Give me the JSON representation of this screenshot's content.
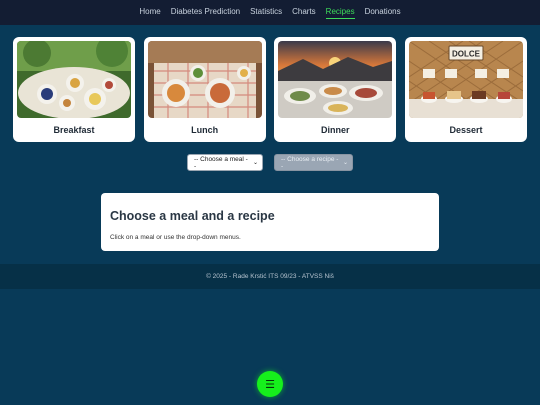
{
  "nav": {
    "items": [
      {
        "label": "Home"
      },
      {
        "label": "Diabetes Prediction"
      },
      {
        "label": "Statistics"
      },
      {
        "label": "Charts"
      },
      {
        "label": "Recipes",
        "active": true
      },
      {
        "label": "Donations"
      }
    ],
    "active_color": "#3ddc5a"
  },
  "meals": [
    {
      "label": "Breakfast"
    },
    {
      "label": "Lunch"
    },
    {
      "label": "Dinner"
    },
    {
      "label": "Dessert",
      "sign_text": "DOLCE"
    }
  ],
  "selects": {
    "meal_placeholder": "-- Choose a meal --",
    "recipe_placeholder": "-- Choose a recipe --"
  },
  "info": {
    "title": "Choose a meal and a recipe",
    "text": "Click on a meal or use the drop-down menus."
  },
  "footer": {
    "text": "© 2025 - Rade Krstić ITS 09/23 - ATVSS Niš"
  },
  "fab": {
    "icon": "menu-icon",
    "symbol": "☰",
    "color": "#16f01c"
  }
}
